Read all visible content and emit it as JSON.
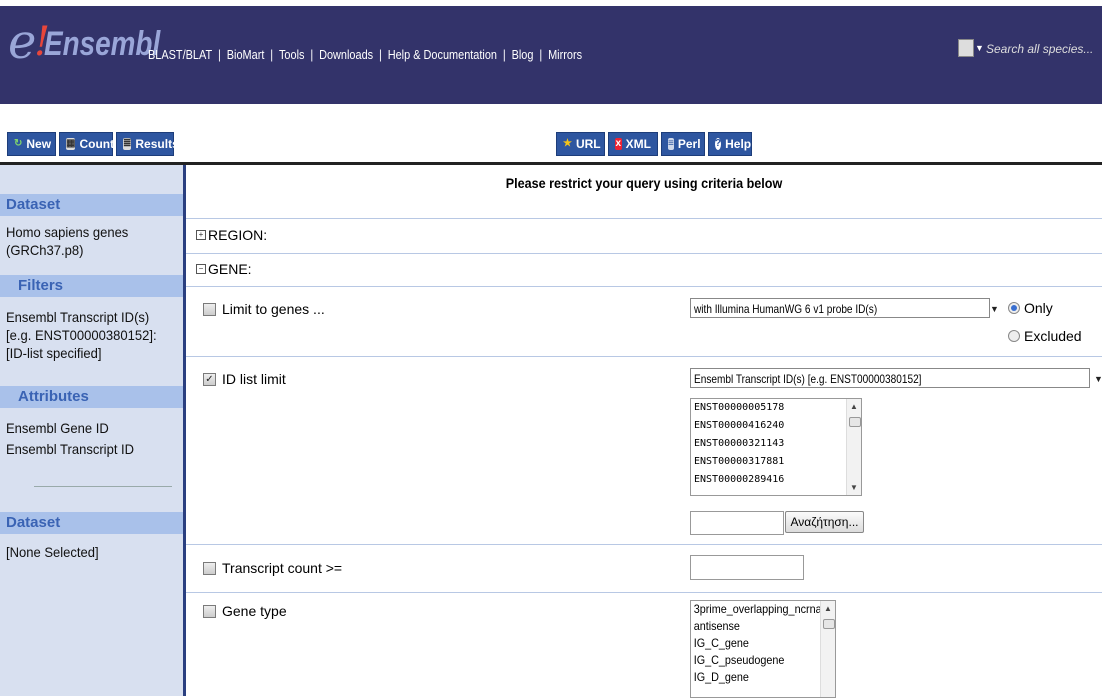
{
  "header": {
    "logo_e": "e",
    "logo_excl": "!",
    "logo_word": "Ensembl",
    "nav": [
      "BLAST/BLAT",
      "BioMart",
      "Tools",
      "Downloads",
      "Help & Documentation",
      "Blog",
      "Mirrors"
    ],
    "search_placeholder": "Search all species..."
  },
  "toolbar": {
    "new_label": "New",
    "count_label": "Count",
    "results_label": "Results",
    "url_label": "URL",
    "xml_label": "XML",
    "perl_label": "Perl",
    "help_label": "Help"
  },
  "sidebar": {
    "dataset_heading": "Dataset",
    "dataset_value": "Homo sapiens genes (GRCh37.p8)",
    "filters_heading": "Filters",
    "filters_value": "Ensembl Transcript ID(s) [e.g. ENST00000380152]: [ID-list specified]",
    "attributes_heading": "Attributes",
    "attribute_1": "Ensembl Gene ID",
    "attribute_2": "Ensembl Transcript ID",
    "dataset2_heading": "Dataset",
    "dataset2_value": "[None Selected]"
  },
  "main": {
    "title": "Please restrict your query using criteria below",
    "region_label": "REGION:",
    "gene_label": "GENE:",
    "limit_label": "Limit to genes ...",
    "limit_select": "with Illumina HumanWG 6 v1 probe ID(s)",
    "radio_only": "Only",
    "radio_excluded": "Excluded",
    "idlist_label": "ID list limit",
    "idlist_select": "Ensembl Transcript ID(s) [e.g. ENST00000380152]",
    "ids": [
      "ENST00000005178",
      "ENST00000416240",
      "ENST00000321143",
      "ENST00000317881",
      "ENST00000289416"
    ],
    "search_button": "Αναζήτηση...",
    "transcript_count_label": "Transcript count >=",
    "gene_type_label": "Gene type",
    "gene_types": [
      "3prime_overlapping_ncrna",
      "antisense",
      "IG_C_gene",
      "IG_C_pseudogene",
      "IG_D_gene"
    ]
  }
}
